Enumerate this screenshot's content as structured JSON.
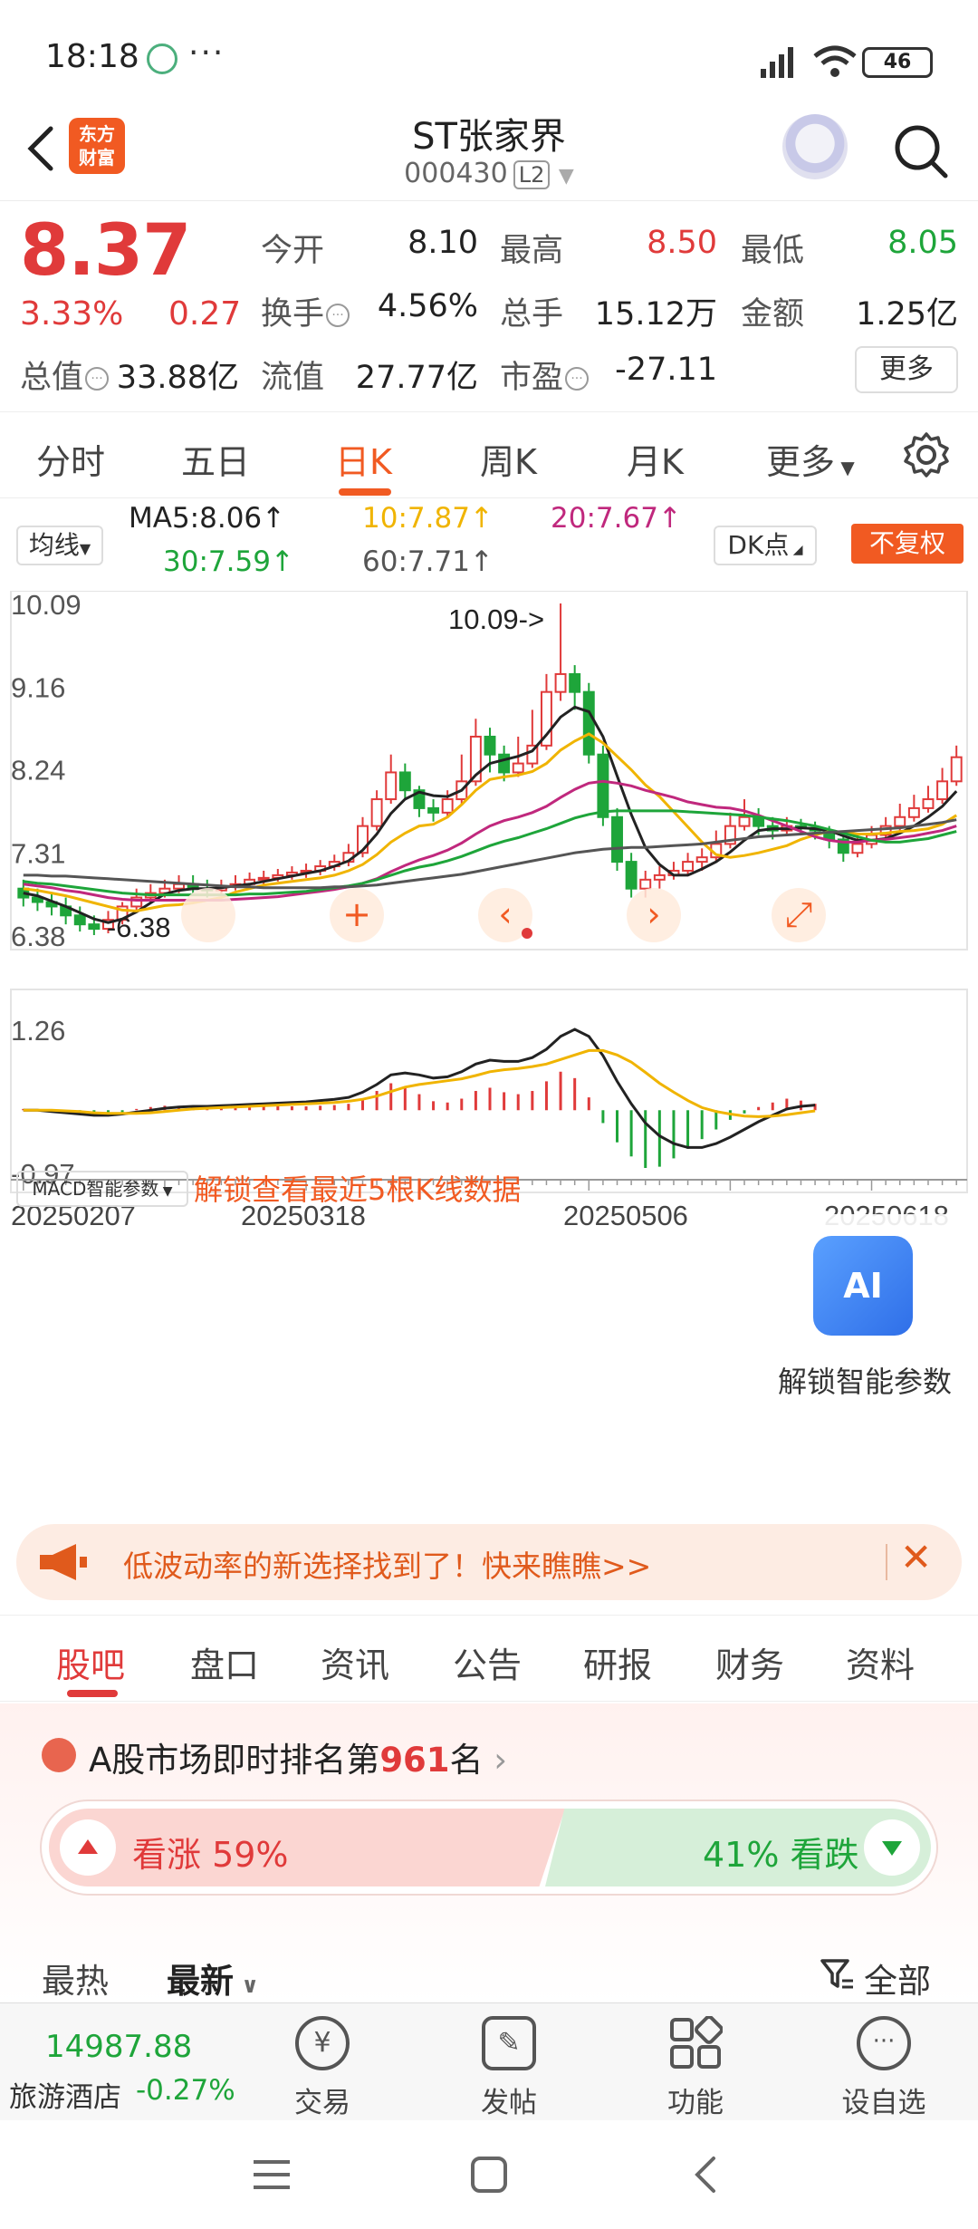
{
  "status_bar": {
    "time": "18:18",
    "dots": "···",
    "battery": "46"
  },
  "header": {
    "logo_line1": "东方",
    "logo_line2": "财富",
    "stock_name": "ST张家界",
    "stock_code": "000430",
    "level": "L2"
  },
  "quote": {
    "price": "8.37",
    "change_pct": "3.33%",
    "change": "0.27",
    "stats": [
      {
        "label": "今开",
        "value": "8.10"
      },
      {
        "label": "最高",
        "value": "8.50"
      },
      {
        "label": "最低",
        "value": "8.05"
      },
      {
        "label": "换手",
        "value": "4.56%"
      },
      {
        "label": "总手",
        "value": "15.12万"
      },
      {
        "label": "金额",
        "value": "1.25亿"
      },
      {
        "label": "总值",
        "value": "33.88亿"
      },
      {
        "label": "流值",
        "value": "27.77亿"
      },
      {
        "label": "市盈",
        "value": "-27.11"
      }
    ],
    "more_label": "更多"
  },
  "period_tabs": [
    "分时",
    "五日",
    "日K",
    "周K",
    "月K",
    "更多"
  ],
  "period_active": "日K",
  "chart_controls": {
    "ma_select": "均线",
    "ma5": "MA5:8.06",
    "ma10": "10:7.87",
    "ma20": "20:7.67",
    "ma30": "30:7.59",
    "ma60": "60:7.71",
    "dk_label": "DK点",
    "fq_label": "不复权",
    "macd_select": "MACD智能参数",
    "unlock_5k": "解锁查看最近5根K线数据",
    "ai_unlock": "解锁智能参数",
    "ai_icon": "AI",
    "max_note": "10.09->",
    "min_note": "-6.38"
  },
  "chart_data": [
    {
      "type": "line",
      "title": "",
      "y_ticks": [
        "10.09",
        "9.16",
        "8.24",
        "7.31",
        "6.38"
      ],
      "ylim": [
        6.38,
        10.09
      ],
      "x_ticks": [
        "20250207",
        "20250318",
        "20250506",
        "20250618"
      ],
      "candles": [
        [
          6.9,
          6.8,
          7.0,
          6.7
        ],
        [
          6.8,
          6.75,
          6.9,
          6.65
        ],
        [
          6.75,
          6.7,
          6.85,
          6.6
        ],
        [
          6.7,
          6.6,
          6.8,
          6.5
        ],
        [
          6.6,
          6.5,
          6.7,
          6.42
        ],
        [
          6.5,
          6.45,
          6.6,
          6.38
        ],
        [
          6.45,
          6.55,
          6.65,
          6.4
        ],
        [
          6.55,
          6.7,
          6.75,
          6.5
        ],
        [
          6.7,
          6.8,
          6.9,
          6.65
        ],
        [
          6.8,
          6.85,
          6.95,
          6.75
        ],
        [
          6.85,
          6.9,
          7.0,
          6.8
        ],
        [
          6.9,
          6.95,
          7.05,
          6.85
        ],
        [
          6.95,
          6.9,
          7.05,
          6.85
        ],
        [
          6.9,
          6.88,
          7.0,
          6.8
        ],
        [
          6.88,
          6.92,
          7.0,
          6.82
        ],
        [
          6.92,
          6.95,
          7.05,
          6.88
        ],
        [
          6.95,
          7.0,
          7.08,
          6.9
        ],
        [
          7.0,
          7.02,
          7.1,
          6.95
        ],
        [
          7.02,
          7.05,
          7.12,
          6.98
        ],
        [
          7.05,
          7.08,
          7.15,
          7.0
        ],
        [
          7.08,
          7.1,
          7.18,
          7.02
        ],
        [
          7.1,
          7.15,
          7.22,
          7.05
        ],
        [
          7.15,
          7.2,
          7.28,
          7.1
        ],
        [
          7.2,
          7.3,
          7.4,
          7.15
        ],
        [
          7.3,
          7.6,
          7.7,
          7.25
        ],
        [
          7.6,
          7.9,
          8.0,
          7.55
        ],
        [
          7.9,
          8.2,
          8.4,
          7.85
        ],
        [
          8.2,
          8.0,
          8.3,
          7.9
        ],
        [
          8.0,
          7.8,
          8.05,
          7.7
        ],
        [
          7.8,
          7.75,
          7.9,
          7.65
        ],
        [
          7.75,
          7.9,
          8.0,
          7.7
        ],
        [
          7.9,
          8.1,
          8.4,
          7.85
        ],
        [
          8.1,
          8.6,
          8.8,
          8.05
        ],
        [
          8.6,
          8.4,
          8.7,
          8.2
        ],
        [
          8.4,
          8.2,
          8.5,
          8.1
        ],
        [
          8.2,
          8.3,
          8.6,
          8.15
        ],
        [
          8.3,
          8.5,
          8.9,
          8.25
        ],
        [
          8.5,
          9.1,
          9.3,
          8.45
        ],
        [
          9.1,
          9.3,
          10.09,
          9.0
        ],
        [
          9.3,
          9.1,
          9.4,
          8.9
        ],
        [
          9.1,
          8.4,
          9.2,
          8.3
        ],
        [
          8.4,
          7.7,
          8.5,
          7.6
        ],
        [
          7.7,
          7.2,
          7.8,
          7.1
        ],
        [
          7.2,
          6.9,
          7.3,
          6.8
        ],
        [
          6.9,
          7.0,
          7.1,
          6.8
        ],
        [
          7.0,
          7.05,
          7.15,
          6.9
        ],
        [
          7.05,
          7.1,
          7.2,
          7.0
        ],
        [
          7.1,
          7.2,
          7.3,
          7.05
        ],
        [
          7.2,
          7.25,
          7.35,
          7.1
        ],
        [
          7.25,
          7.4,
          7.55,
          7.2
        ],
        [
          7.4,
          7.6,
          7.75,
          7.35
        ],
        [
          7.6,
          7.7,
          7.9,
          7.55
        ],
        [
          7.7,
          7.6,
          7.8,
          7.5
        ],
        [
          7.6,
          7.55,
          7.7,
          7.45
        ],
        [
          7.55,
          7.6,
          7.7,
          7.5
        ],
        [
          7.6,
          7.58,
          7.68,
          7.5
        ],
        [
          7.58,
          7.55,
          7.65,
          7.45
        ],
        [
          7.55,
          7.45,
          7.6,
          7.35
        ],
        [
          7.45,
          7.3,
          7.5,
          7.2
        ],
        [
          7.3,
          7.4,
          7.5,
          7.25
        ],
        [
          7.4,
          7.5,
          7.6,
          7.35
        ],
        [
          7.5,
          7.6,
          7.7,
          7.45
        ],
        [
          7.6,
          7.7,
          7.85,
          7.55
        ],
        [
          7.7,
          7.8,
          7.95,
          7.65
        ],
        [
          7.8,
          7.9,
          8.05,
          7.75
        ],
        [
          7.9,
          8.1,
          8.25,
          7.85
        ],
        [
          8.1,
          8.37,
          8.5,
          8.05
        ]
      ],
      "ma_series": [
        {
          "name": "MA5",
          "color": "#222222",
          "values": [
            6.85,
            6.82,
            6.76,
            6.7,
            6.63,
            6.56,
            6.52,
            6.56,
            6.64,
            6.74,
            6.84,
            6.88,
            6.9,
            6.9,
            6.91,
            6.93,
            6.95,
            6.98,
            7.01,
            7.04,
            7.07,
            7.1,
            7.15,
            7.21,
            7.33,
            7.51,
            7.74,
            7.9,
            7.98,
            7.94,
            7.93,
            8.0,
            8.17,
            8.3,
            8.34,
            8.38,
            8.44,
            8.62,
            8.82,
            8.93,
            8.88,
            8.6,
            8.16,
            7.73,
            7.36,
            7.17,
            7.05,
            7.05,
            7.12,
            7.2,
            7.31,
            7.44,
            7.55,
            7.57,
            7.57,
            7.58,
            7.57,
            7.55,
            7.49,
            7.44,
            7.44,
            7.46,
            7.52,
            7.6,
            7.7,
            7.82,
            7.99
          ]
        },
        {
          "name": "10",
          "color": "#f0b400",
          "values": [
            6.9,
            6.88,
            6.85,
            6.82,
            6.78,
            6.74,
            6.7,
            6.66,
            6.65,
            6.68,
            6.71,
            6.72,
            6.74,
            6.77,
            6.8,
            6.86,
            6.9,
            6.94,
            6.96,
            6.98,
            7.0,
            7.02,
            7.05,
            7.1,
            7.17,
            7.28,
            7.42,
            7.52,
            7.6,
            7.62,
            7.7,
            7.84,
            8.0,
            8.12,
            8.15,
            8.17,
            8.21,
            8.3,
            8.45,
            8.55,
            8.63,
            8.53,
            8.38,
            8.23,
            8.06,
            7.93,
            7.76,
            7.59,
            7.42,
            7.28,
            7.25,
            7.27,
            7.3,
            7.34,
            7.38,
            7.45,
            7.5,
            7.54,
            7.53,
            7.51,
            7.51,
            7.52,
            7.54,
            7.55,
            7.57,
            7.62,
            7.72
          ]
        },
        {
          "name": "20",
          "color": "#c0287d",
          "values": [
            6.95,
            6.93,
            6.91,
            6.88,
            6.86,
            6.83,
            6.8,
            6.78,
            6.77,
            6.77,
            6.77,
            6.77,
            6.77,
            6.77,
            6.77,
            6.78,
            6.79,
            6.8,
            6.81,
            6.83,
            6.85,
            6.87,
            6.89,
            6.92,
            6.96,
            7.01,
            7.09,
            7.16,
            7.22,
            7.27,
            7.33,
            7.41,
            7.51,
            7.6,
            7.66,
            7.7,
            7.75,
            7.82,
            7.92,
            8.01,
            8.08,
            8.1,
            8.08,
            8.05,
            8.0,
            7.96,
            7.92,
            7.87,
            7.84,
            7.81,
            7.8,
            7.77,
            7.72,
            7.66,
            7.6,
            7.54,
            7.48,
            7.44,
            7.42,
            7.42,
            7.44,
            7.45,
            7.47,
            7.49,
            7.52,
            7.55,
            7.6
          ]
        },
        {
          "name": "30",
          "color": "#1ea53a",
          "values": [
            6.98,
            6.96,
            6.95,
            6.93,
            6.91,
            6.89,
            6.87,
            6.85,
            6.84,
            6.83,
            6.83,
            6.83,
            6.83,
            6.83,
            6.83,
            6.83,
            6.84,
            6.84,
            6.85,
            6.86,
            6.87,
            6.89,
            6.91,
            6.93,
            6.96,
            7.0,
            7.05,
            7.1,
            7.14,
            7.17,
            7.21,
            7.26,
            7.32,
            7.38,
            7.43,
            7.47,
            7.52,
            7.57,
            7.63,
            7.69,
            7.73,
            7.76,
            7.77,
            7.77,
            7.77,
            7.77,
            7.77,
            7.76,
            7.75,
            7.74,
            7.73,
            7.72,
            7.7,
            7.68,
            7.66,
            7.63,
            7.6,
            7.56,
            7.52,
            7.48,
            7.44,
            7.42,
            7.42,
            7.44,
            7.46,
            7.5,
            7.54
          ]
        },
        {
          "name": "60",
          "color": "#555555",
          "values": [
            7.05,
            7.05,
            7.04,
            7.04,
            7.03,
            7.02,
            7.01,
            7.0,
            6.99,
            6.98,
            6.97,
            6.96,
            6.95,
            6.94,
            6.93,
            6.92,
            6.92,
            6.91,
            6.91,
            6.91,
            6.91,
            6.91,
            6.92,
            6.92,
            6.93,
            6.94,
            6.96,
            6.98,
            7.0,
            7.02,
            7.04,
            7.06,
            7.09,
            7.12,
            7.15,
            7.18,
            7.21,
            7.24,
            7.27,
            7.3,
            7.32,
            7.34,
            7.35,
            7.36,
            7.36,
            7.37,
            7.38,
            7.39,
            7.4,
            7.42,
            7.44,
            7.46,
            7.48,
            7.49,
            7.5,
            7.51,
            7.52,
            7.53,
            7.54,
            7.55,
            7.56,
            7.57,
            7.58,
            7.6,
            7.62,
            7.64,
            7.67
          ]
        }
      ]
    },
    {
      "type": "bar",
      "title": "",
      "y_ticks": [
        "1.26",
        "-0.97"
      ],
      "ylim": [
        -0.97,
        1.26
      ],
      "visible_bars": 57,
      "macd_bars": [
        0.02,
        0.01,
        0.0,
        -0.02,
        -0.04,
        -0.06,
        -0.05,
        -0.03,
        0.02,
        0.05,
        0.07,
        0.06,
        0.05,
        0.04,
        0.05,
        0.05,
        0.05,
        0.06,
        0.06,
        0.06,
        0.06,
        0.07,
        0.08,
        0.1,
        0.18,
        0.3,
        0.42,
        0.36,
        0.25,
        0.14,
        0.12,
        0.18,
        0.3,
        0.35,
        0.28,
        0.25,
        0.3,
        0.45,
        0.6,
        0.5,
        0.2,
        -0.2,
        -0.5,
        -0.72,
        -0.9,
        -0.88,
        -0.75,
        -0.6,
        -0.45,
        -0.3,
        -0.15,
        -0.05,
        0.05,
        0.12,
        0.18,
        0.15,
        0.1
      ],
      "dif": [
        0.0,
        0.0,
        -0.02,
        -0.04,
        -0.06,
        -0.08,
        -0.08,
        -0.06,
        -0.03,
        0.0,
        0.03,
        0.05,
        0.06,
        0.06,
        0.07,
        0.08,
        0.09,
        0.1,
        0.11,
        0.12,
        0.13,
        0.15,
        0.17,
        0.2,
        0.28,
        0.4,
        0.55,
        0.58,
        0.55,
        0.5,
        0.52,
        0.6,
        0.72,
        0.78,
        0.76,
        0.76,
        0.82,
        0.95,
        1.15,
        1.26,
        1.15,
        0.85,
        0.45,
        0.1,
        -0.2,
        -0.4,
        -0.52,
        -0.58,
        -0.58,
        -0.52,
        -0.42,
        -0.3,
        -0.18,
        -0.08,
        0.02,
        0.06,
        0.08
      ],
      "dea": [
        0.0,
        0.0,
        0.0,
        -0.01,
        -0.02,
        -0.04,
        -0.05,
        -0.05,
        -0.05,
        -0.04,
        -0.02,
        0.0,
        0.02,
        0.03,
        0.04,
        0.05,
        0.06,
        0.07,
        0.08,
        0.09,
        0.1,
        0.11,
        0.12,
        0.14,
        0.17,
        0.22,
        0.29,
        0.36,
        0.4,
        0.43,
        0.46,
        0.49,
        0.54,
        0.6,
        0.63,
        0.65,
        0.68,
        0.72,
        0.79,
        0.86,
        0.93,
        0.93,
        0.86,
        0.75,
        0.59,
        0.42,
        0.28,
        0.15,
        0.04,
        -0.02,
        -0.06,
        -0.09,
        -0.1,
        -0.09,
        -0.07,
        -0.04,
        -0.01
      ]
    }
  ],
  "banner": {
    "text": "低波动率的新选择找到了！快来瞧瞧>>"
  },
  "bottom_tabs": [
    "股吧",
    "盘口",
    "资讯",
    "公告",
    "研报",
    "财务",
    "资料"
  ],
  "bottom_active": "股吧",
  "ranking": {
    "prefix": "A股市场即时排名第",
    "rank": "961",
    "suffix": "名"
  },
  "vote": {
    "up_label": "看涨 59%",
    "down_label": "41% 看跌",
    "up_pct": 59,
    "down_pct": 41
  },
  "sort": {
    "hot": "最热",
    "new": "最新",
    "all": "全部"
  },
  "bottom_nav": {
    "index_value": "14987.88",
    "index_name": "旅游酒店",
    "index_change": "-0.27%",
    "items": [
      "交易",
      "发帖",
      "功能",
      "设自选"
    ]
  }
}
